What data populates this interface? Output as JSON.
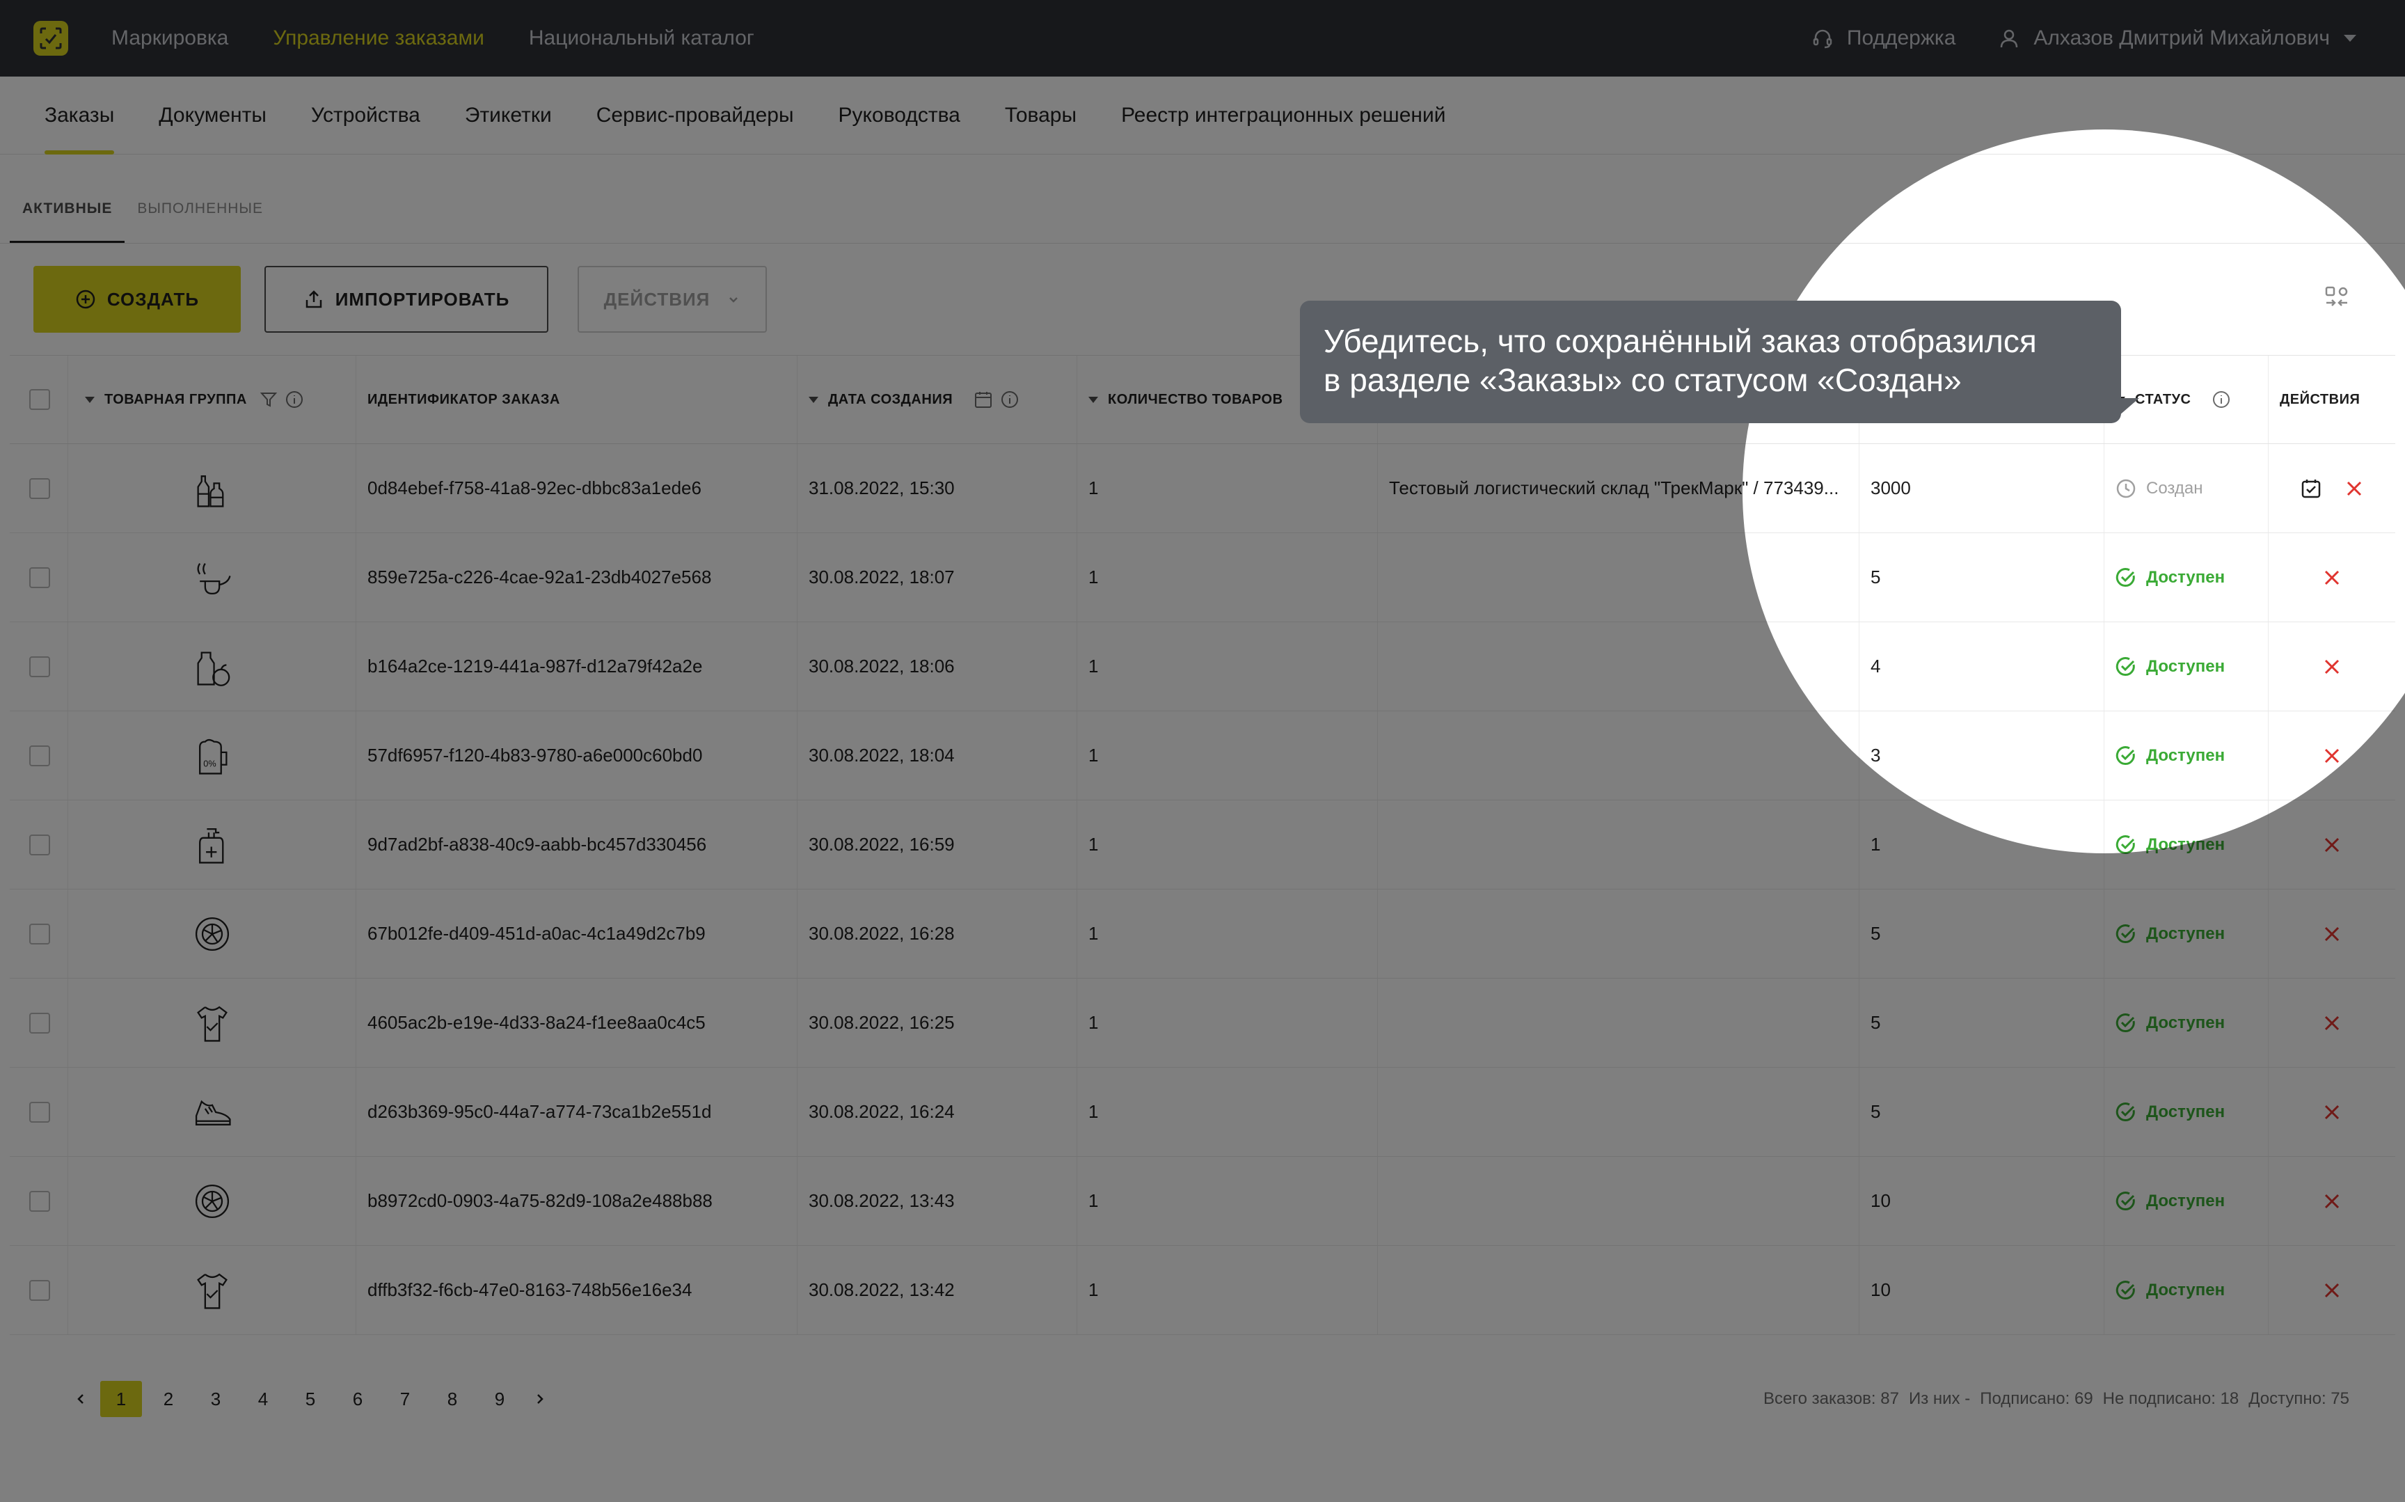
{
  "topbar": {
    "nav": [
      "Маркировка",
      "Управление заказами",
      "Национальный каталог"
    ],
    "active_nav": 1,
    "support": "Поддержка",
    "user": "Алхазов Дмитрий Михайлович"
  },
  "subnav": {
    "tabs": [
      "Заказы",
      "Документы",
      "Устройства",
      "Этикетки",
      "Сервис-провайдеры",
      "Руководства",
      "Товары",
      "Реестр интеграционных решений"
    ],
    "active_tab": 0
  },
  "status_tabs": {
    "active": "АКТИВНЫЕ",
    "done": "ВЫПОЛНЕННЫЕ"
  },
  "toolbar": {
    "create": "СОЗДАТЬ",
    "import": "ИМПОРТИРОВАТЬ",
    "actions": "ДЕЙСТВИЯ"
  },
  "table": {
    "headers": {
      "group": "ТОВАРНАЯ ГРУППА",
      "id": "ИДЕНТИФИКАТОР ЗАКАЗА",
      "date": "ДАТА СОЗДАНИЯ",
      "qty": "КОЛИЧЕСТВО ТОВАРОВ",
      "status": "СТАТУС",
      "actions": "ДЕЙСТВИЯ"
    },
    "rows": [
      {
        "icon": "bottles-icon",
        "id": "0d84ebef-f758-41a8-92ec-dbbc83a1ede6",
        "date": "31.08.2022, 15:30",
        "qty": "1",
        "warehouse": "Тестовый логистический склад \"ТрекМарк\" / 773439...",
        "codes": "3000",
        "status": "Создан"
      },
      {
        "icon": "pipe-icon",
        "id": "859e725a-c226-4cae-92a1-23db4027e568",
        "date": "30.08.2022, 18:07",
        "qty": "1",
        "warehouse": "",
        "codes": "5",
        "status": "Доступен"
      },
      {
        "icon": "milk-apple-icon",
        "id": "b164a2ce-1219-441a-987f-d12a79f42a2e",
        "date": "30.08.2022, 18:06",
        "qty": "1",
        "warehouse": "",
        "codes": "4",
        "status": "Доступен"
      },
      {
        "icon": "beer-mug-icon",
        "id": "57df6957-f120-4b83-9780-a6e000c60bd0",
        "date": "30.08.2022, 18:04",
        "qty": "1",
        "warehouse": "",
        "codes": "3",
        "status": "Доступен"
      },
      {
        "icon": "antiseptic-icon",
        "id": "9d7ad2bf-a838-40c9-aabb-bc457d330456",
        "date": "30.08.2022, 16:59",
        "qty": "1",
        "warehouse": "",
        "codes": "1",
        "status": "Доступен"
      },
      {
        "icon": "tire-icon",
        "id": "67b012fe-d409-451d-a0ac-4c1a49d2c7b9",
        "date": "30.08.2022, 16:28",
        "qty": "1",
        "warehouse": "",
        "codes": "5",
        "status": "Доступен"
      },
      {
        "icon": "shirt-icon",
        "id": "4605ac2b-e19e-4d33-8a24-f1ee8aa0c4c5",
        "date": "30.08.2022, 16:25",
        "qty": "1",
        "warehouse": "",
        "codes": "5",
        "status": "Доступен"
      },
      {
        "icon": "shoe-icon",
        "id": "d263b369-95c0-44a7-a774-73ca1b2e551d",
        "date": "30.08.2022, 16:24",
        "qty": "1",
        "warehouse": "",
        "codes": "5",
        "status": "Доступен"
      },
      {
        "icon": "tire-icon",
        "id": "b8972cd0-0903-4a75-82d9-108a2e488b88",
        "date": "30.08.2022, 13:43",
        "qty": "1",
        "warehouse": "",
        "codes": "10",
        "status": "Доступен"
      },
      {
        "icon": "shirt-icon",
        "id": "dffb3f32-f6cb-47e0-8163-748b56e16e34",
        "date": "30.08.2022, 13:42",
        "qty": "1",
        "warehouse": "",
        "codes": "10",
        "status": "Доступен"
      }
    ]
  },
  "pagination": {
    "pages": [
      "1",
      "2",
      "3",
      "4",
      "5",
      "6",
      "7",
      "8",
      "9"
    ],
    "current": "1"
  },
  "totals": {
    "total": "Всего заказов: 87",
    "of_them": "Из них -",
    "signed": "Подписано: 69",
    "unsigned": "Не подписано: 18",
    "available": "Доступно: 75"
  },
  "tooltip": {
    "line1": "Убедитесь, что сохранённый заказ отобразился",
    "line2": "в разделе «Заказы» со статусом «Создан»"
  },
  "colors": {
    "accent": "#d9d21f",
    "topbar": "#2f3137",
    "success": "#3aaa35",
    "danger": "#e0342f",
    "tooltip": "#5c6066"
  }
}
